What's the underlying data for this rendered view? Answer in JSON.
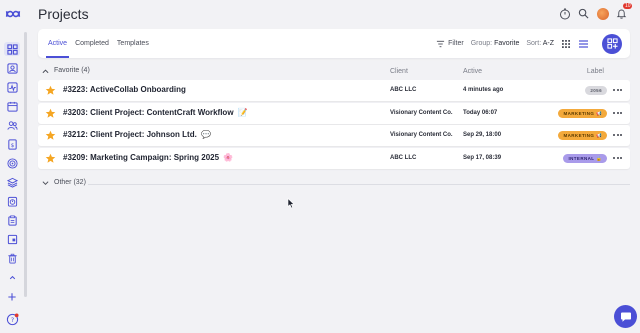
{
  "colors": {
    "accent": "#4b4fd6",
    "star": "#f5a623",
    "background": "#f2f2f5"
  },
  "header": {
    "title": "Projects",
    "notification_count": "10",
    "icons": [
      "timer-icon",
      "search-icon",
      "avatar",
      "bell-icon"
    ]
  },
  "sidebar": {
    "items": [
      {
        "icon": "grid-icon",
        "active": true
      },
      {
        "icon": "user-card-icon"
      },
      {
        "icon": "activity-icon"
      },
      {
        "icon": "calendar-icon"
      },
      {
        "icon": "people-icon"
      },
      {
        "icon": "invoice-icon"
      },
      {
        "icon": "target-icon"
      },
      {
        "icon": "layers-icon"
      },
      {
        "icon": "timer-icon"
      },
      {
        "icon": "clipboard-icon"
      },
      {
        "icon": "inbox-icon"
      },
      {
        "icon": "trash-icon"
      },
      {
        "icon": "chevron-up-icon"
      }
    ],
    "add_icon": "plus-icon",
    "help_icon": "help-icon"
  },
  "toolbar": {
    "tabs": [
      {
        "label": "Active",
        "active": true
      },
      {
        "label": "Completed"
      },
      {
        "label": "Templates"
      }
    ],
    "filter_label": "Filter",
    "group_label": "Group:",
    "group_value": "Favorite",
    "sort_label": "Sort:",
    "sort_value": "A-Z"
  },
  "columns": {
    "client": "Client",
    "active": "Active",
    "label": "Label"
  },
  "groups": {
    "favorite": "Favorite (4)",
    "other": "Other (32)"
  },
  "projects": [
    {
      "name": "#3223: ActiveCollab Onboarding",
      "emoji": "",
      "client": "ABC LLC",
      "active": "4 minutes ago",
      "label": "2056",
      "label_bg": "#d9d9de",
      "label_fg": "#5a5d68"
    },
    {
      "name": "#3203: Client Project: ContentCraft Workflow",
      "emoji": "📝",
      "client": "Visionary Content Co.",
      "active": "Today 06:07",
      "label": "MARKETING 📢",
      "label_bg": "#f3a93b",
      "label_fg": "#5a3a00"
    },
    {
      "name": "#3212: Client Project: Johnson Ltd.",
      "emoji": "💬",
      "client": "Visionary Content Co.",
      "active": "Sep 29, 18:00",
      "label": "MARKETING 📢",
      "label_bg": "#f3a93b",
      "label_fg": "#5a3a00"
    },
    {
      "name": "#3209: Marketing Campaign: Spring 2025",
      "emoji": "🌸",
      "client": "ABC LLC",
      "active": "Sep 17, 08:39",
      "label": "INTERNAL 🔒",
      "label_bg": "#a99bea",
      "label_fg": "#2e2270"
    }
  ]
}
